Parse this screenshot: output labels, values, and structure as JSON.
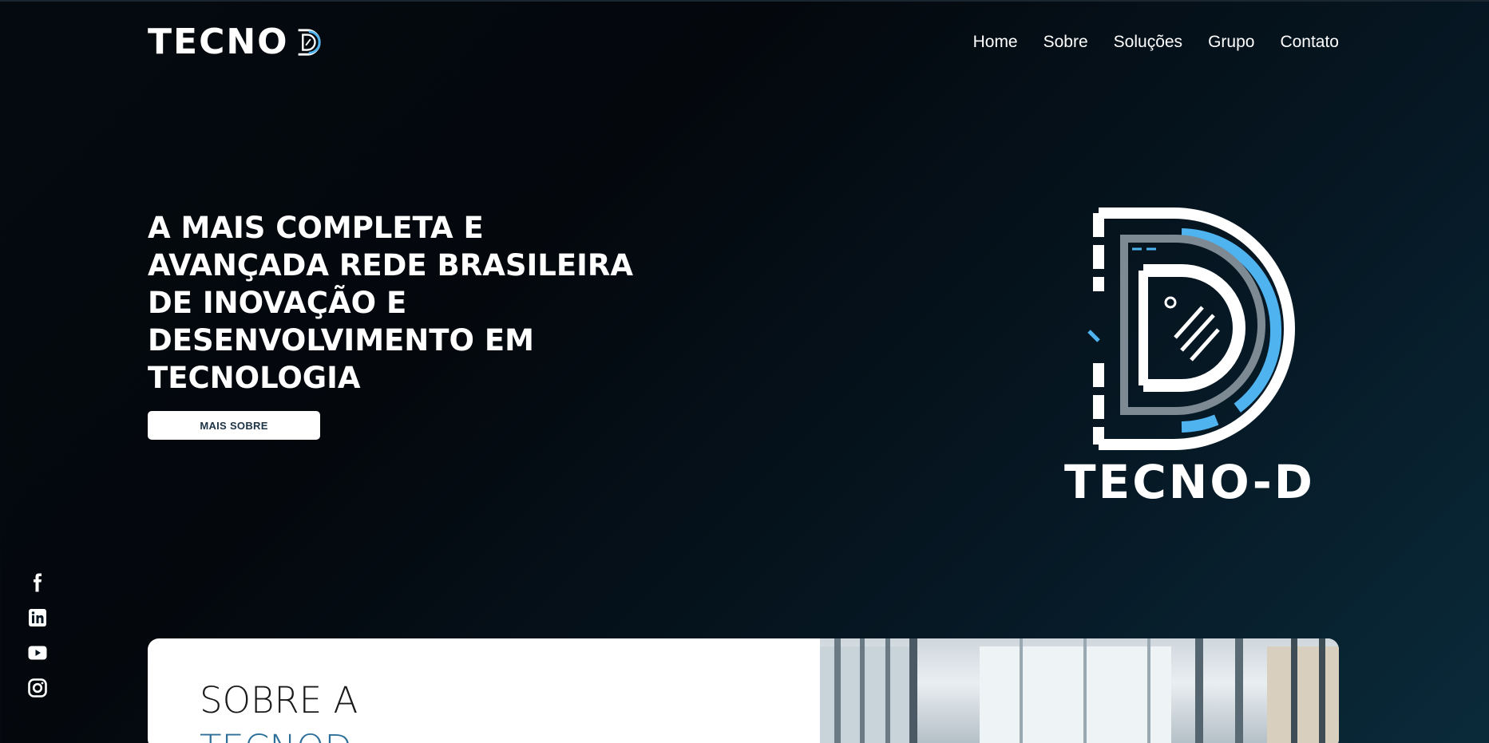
{
  "header": {
    "logo_text": "TECNO",
    "nav": [
      {
        "label": "Home"
      },
      {
        "label": "Sobre"
      },
      {
        "label": "Soluções"
      },
      {
        "label": "Grupo"
      },
      {
        "label": "Contato"
      }
    ]
  },
  "hero": {
    "title": "A MAIS COMPLETA E AVANÇADA REDE BRASILEIRA DE INOVAÇÃO E DESENVOLVIMENTO EM TECNOLOGIA",
    "button_label": "MAIS SOBRE",
    "logo_text": "TECNO-D"
  },
  "social": [
    {
      "icon": "facebook-icon"
    },
    {
      "icon": "linkedin-icon"
    },
    {
      "icon": "youtube-icon"
    },
    {
      "icon": "instagram-icon"
    }
  ],
  "about": {
    "title_line1": "SOBRE A",
    "title_line2": "TECNOD"
  },
  "colors": {
    "accent_blue": "#4fb3f0",
    "button_text": "#1d3346",
    "about_accent": "#2e6f99"
  }
}
